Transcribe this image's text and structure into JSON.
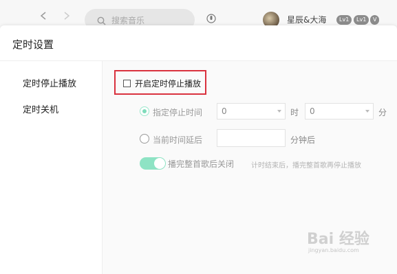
{
  "topbar": {
    "search_placeholder": "搜索音乐",
    "username": "星辰&大海",
    "badges": [
      "Lv1",
      "Lv1",
      "V"
    ]
  },
  "dialog": {
    "title": "定时设置",
    "sidebar": [
      "定时停止播放",
      "定时关机"
    ],
    "enable_label": "开启定时停止播放",
    "option_specified": {
      "label": "指定停止时间",
      "hour_value": "0",
      "hour_unit": "时",
      "minute_value": "0",
      "minute_unit": "分"
    },
    "option_delay": {
      "label": "当前时间延后",
      "value": "",
      "unit": "分钟后"
    },
    "finish_song": {
      "label": "播完整首歌后关闭",
      "hint": "计时结束后，播完整首歌再停止播放"
    }
  },
  "watermark": {
    "main": "Bai 经验",
    "sub": "jingyan.baidu.com"
  }
}
